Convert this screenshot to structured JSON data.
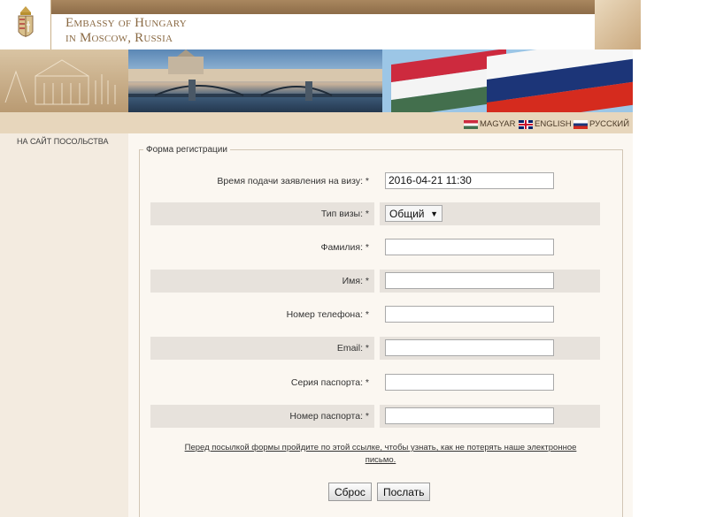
{
  "header": {
    "title_line1": "Embassy of Hungary",
    "title_line2": "in Moscow, Russia"
  },
  "languages": [
    {
      "label": "MAGYAR",
      "icon": "hungary-flag-icon"
    },
    {
      "label": "ENGLISH",
      "icon": "uk-flag-icon"
    },
    {
      "label": "РУССКИЙ",
      "icon": "russia-flag-icon"
    }
  ],
  "sidebar": {
    "link_label": "НА САЙТ ПОСОЛЬСТВА"
  },
  "form": {
    "legend": "Форма регистрации",
    "fields": [
      {
        "label": "Время подачи заявления на визу: *",
        "value": "2016-04-21 11:30"
      },
      {
        "label": "Тип визы: *",
        "value": "Общий"
      },
      {
        "label": "Фамилия: *",
        "value": ""
      },
      {
        "label": "Имя: *",
        "value": ""
      },
      {
        "label": "Номер телефона: *",
        "value": ""
      },
      {
        "label": "Email: *",
        "value": ""
      },
      {
        "label": "Серия паспорта: *",
        "value": ""
      },
      {
        "label": "Номер паспорта: *",
        "value": ""
      }
    ],
    "note": "Перед посылкой формы пройдите по этой ссылке, чтобы узнать, как не потерять наше электронное письмо.",
    "reset_label": "Сброс",
    "submit_label": "Послать"
  },
  "colors": {
    "brand_gold": "#8a6a44",
    "hungary_red": "#cd2a3e",
    "hungary_green": "#436f4d",
    "russia_blue": "#1c3578"
  }
}
